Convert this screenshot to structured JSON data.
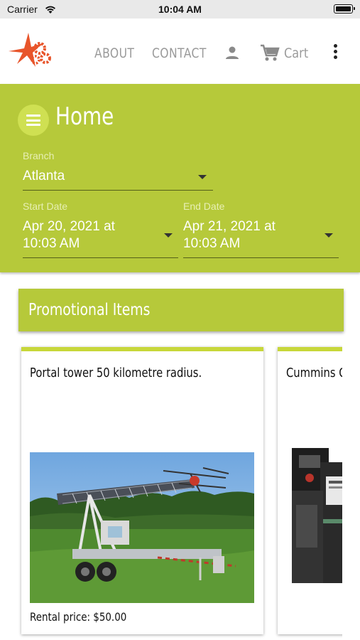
{
  "status_bar": {
    "carrier": "Carrier",
    "time": "10:04 AM"
  },
  "nav": {
    "about": "ABOUT",
    "contact": "CONTACT",
    "cart": "Cart"
  },
  "header": {
    "title": "Home",
    "branch": {
      "label": "Branch",
      "value": "Atlanta"
    },
    "start_date": {
      "label": "Start Date",
      "value_line1": "Apr 20, 2021 at",
      "value_line2": "10:03 AM"
    },
    "end_date": {
      "label": "End Date",
      "value_line1": "Apr 21, 2021 at",
      "value_line2": "10:03 AM"
    }
  },
  "promo": {
    "title": "Promotional Items",
    "items": [
      {
        "title": "Portal tower 50 kilometre radius.",
        "price": "Rental price: $50.00"
      },
      {
        "title": "Cummins O"
      }
    ]
  },
  "colors": {
    "brand_green": "#b6c93a",
    "logo_orange": "#e8552b",
    "status_bar": "#e9e9e9"
  },
  "icons": [
    "wifi-icon",
    "battery-icon",
    "user-icon",
    "cart-icon",
    "more-vertical-icon",
    "hamburger-menu-icon",
    "chevron-down-icon"
  ]
}
